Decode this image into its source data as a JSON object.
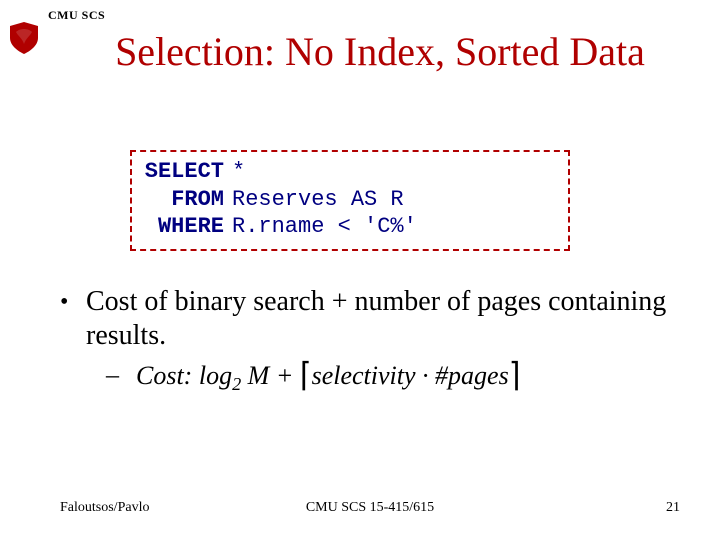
{
  "header": {
    "org": "CMU SCS"
  },
  "title": "Selection: No Index, Sorted Data",
  "sql": {
    "kw_select": "SELECT",
    "select": "*",
    "kw_from": "FROM",
    "from": "Reserves AS R",
    "kw_where": "WHERE",
    "where": "R.rname < 'C%'"
  },
  "bullet": {
    "dot": "•",
    "text": "Cost of binary search + number of pages containing results."
  },
  "cost": {
    "dash": "–",
    "label": "Cost: log",
    "sub": "2",
    "M": " M + ",
    "sel": "selectivity",
    "dot": " · ",
    "pages": "#pages"
  },
  "footer": {
    "left": "Faloutsos/Pavlo",
    "center": "CMU SCS 15-415/615",
    "right": "21"
  },
  "icons": {
    "crest_color": "#b00000"
  }
}
